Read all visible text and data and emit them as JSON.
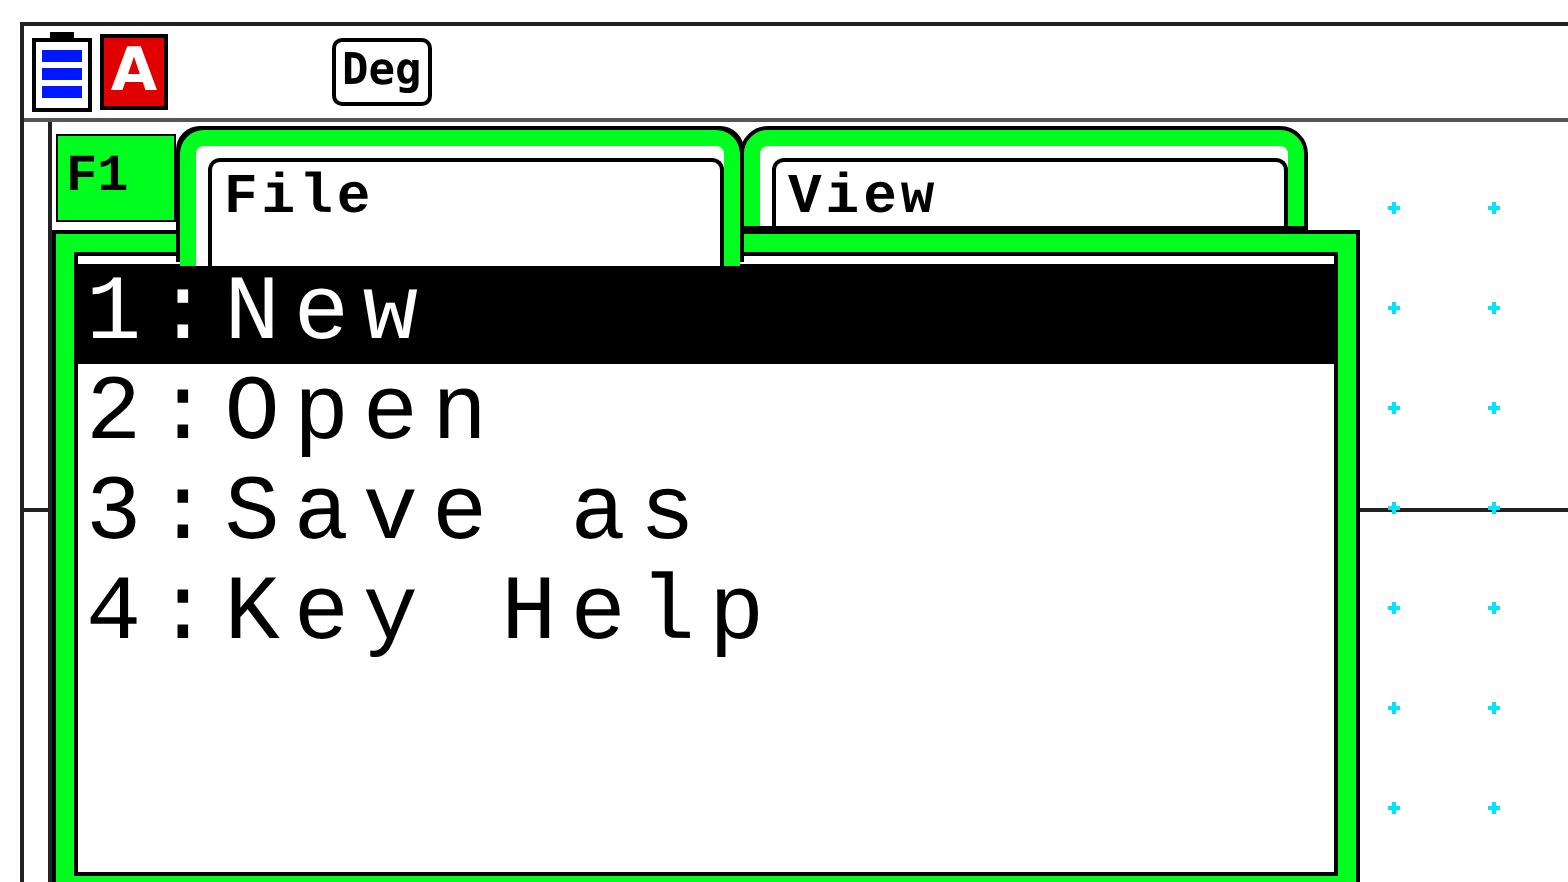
{
  "status_bar": {
    "input_mode": "A",
    "angle_unit": "Deg"
  },
  "menu": {
    "function_key": "F1",
    "tabs": [
      {
        "label": "File",
        "selected": true
      },
      {
        "label": "View",
        "selected": false
      }
    ],
    "items": [
      {
        "label": "1:New",
        "selected": true
      },
      {
        "label": "2:Open",
        "selected": false
      },
      {
        "label": "3:Save as",
        "selected": false
      },
      {
        "label": "4:Key Help",
        "selected": false
      }
    ]
  }
}
